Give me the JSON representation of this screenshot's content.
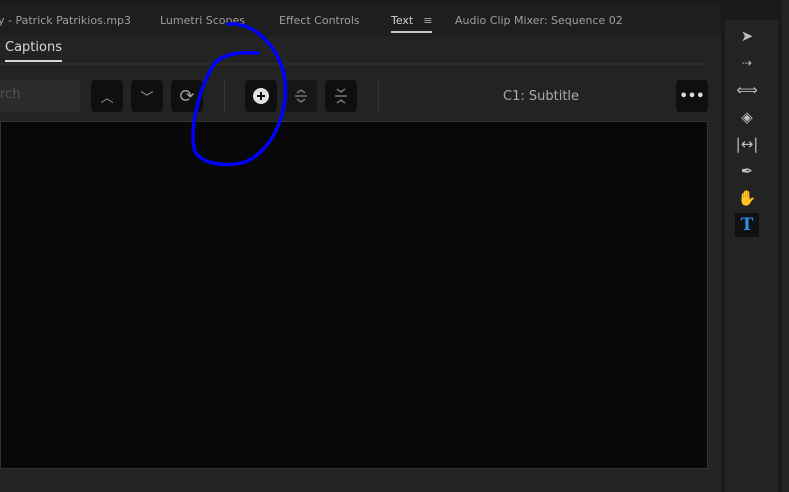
{
  "tabs": [
    {
      "label": "y - Patrick Patrikios.mp3"
    },
    {
      "label": "Lumetri Scopes"
    },
    {
      "label": "Effect Controls"
    },
    {
      "label": "Text",
      "active": true
    },
    {
      "label": "Audio Clip Mixer: Sequence 02"
    }
  ],
  "subtab": "Captions",
  "search_placeholder": "rch",
  "track_label": "C1: Subtitle",
  "icons": {
    "prev": "chevron-up",
    "next": "chevron-down",
    "refresh": "sync",
    "add": "plus-circle",
    "split": "split",
    "merge": "merge",
    "more": "ellipsis"
  },
  "tools": [
    "selection",
    "track-select-forward",
    "ripple-edit",
    "razor",
    "slip",
    "pen",
    "hand",
    "type"
  ],
  "accent": "#2e8cf0",
  "annotation_color": "#0000ff"
}
